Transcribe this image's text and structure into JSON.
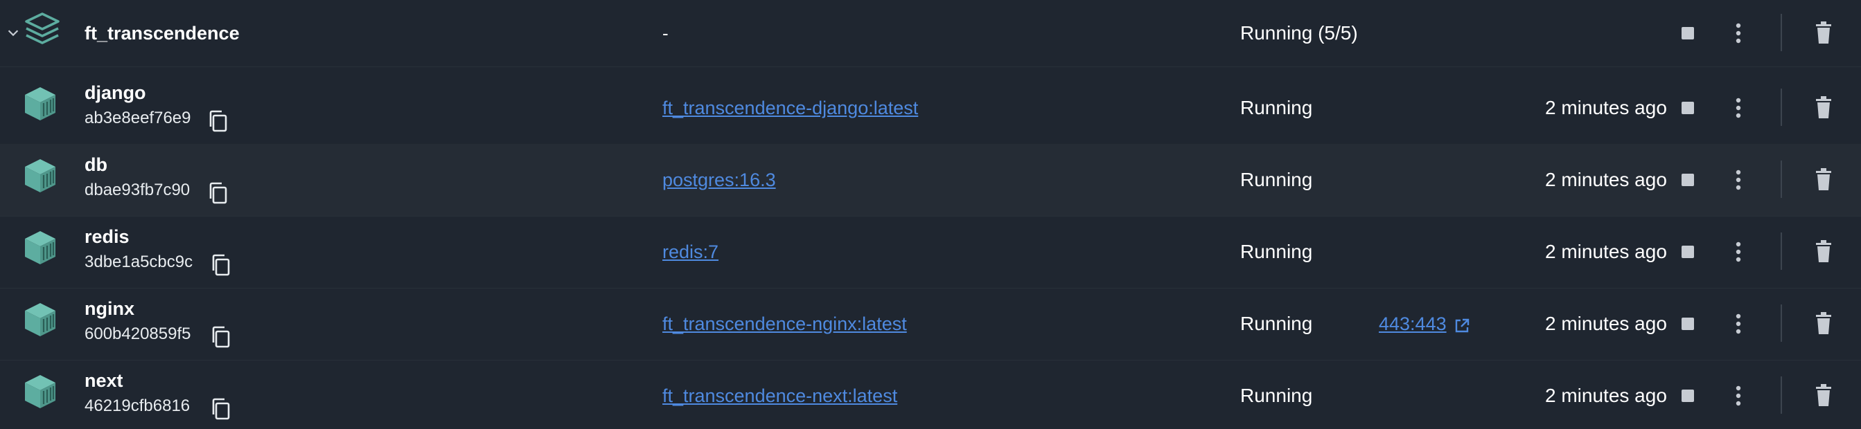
{
  "group": {
    "name": "ft_transcendence",
    "image": "-",
    "status": "Running (5/5)",
    "icon": "stack-icon"
  },
  "containers": [
    {
      "name": "django",
      "id": "ab3e8eef76e9",
      "image": "ft_transcendence-django:latest",
      "status": "Running",
      "port": "",
      "time": "2 minutes ago"
    },
    {
      "name": "db",
      "id": "dbae93fb7c90",
      "image": "postgres:16.3",
      "status": "Running",
      "port": "",
      "time": "2 minutes ago"
    },
    {
      "name": "redis",
      "id": "3dbe1a5cbc9c",
      "image": "redis:7",
      "status": "Running",
      "port": "",
      "time": "2 minutes ago"
    },
    {
      "name": "nginx",
      "id": "600b420859f5",
      "image": "ft_transcendence-nginx:latest",
      "status": "Running",
      "port": "443:443",
      "time": "2 minutes ago"
    },
    {
      "name": "next",
      "id": "46219cfb6816",
      "image": "ft_transcendence-next:latest",
      "status": "Running",
      "port": "",
      "time": "2 minutes ago"
    }
  ],
  "colors": {
    "background": "#1f2630",
    "row_alt": "#252c35",
    "link": "#4f8ae0",
    "container_icon": "#5dada0",
    "icon_gray": "#c7ccd3"
  }
}
